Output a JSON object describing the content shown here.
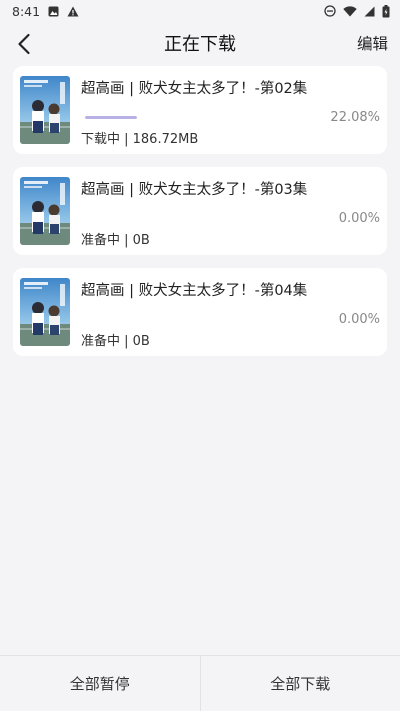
{
  "statusbar": {
    "time": "8:41"
  },
  "header": {
    "title": "正在下载",
    "edit_label": "编辑"
  },
  "downloads": [
    {
      "title": "超高画 | 败犬女主太多了！-第02集",
      "progress_percent": 22.08,
      "percent_label": "22.08%",
      "status": "下载中 | 186.72MB"
    },
    {
      "title": "超高画 | 败犬女主太多了！-第03集",
      "progress_percent": 0,
      "percent_label": "0.00%",
      "status": "准备中 | 0B"
    },
    {
      "title": "超高画 | 败犬女主太多了！-第04集",
      "progress_percent": 0,
      "percent_label": "0.00%",
      "status": "准备中 | 0B"
    }
  ],
  "bottom_actions": {
    "pause_all": "全部暂停",
    "download_all": "全部下载"
  },
  "colors": {
    "progress": "#b8b1e6",
    "background": "#f4f4f6"
  }
}
